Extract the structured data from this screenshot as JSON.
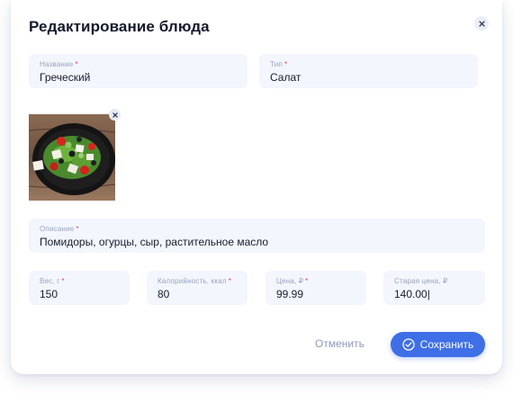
{
  "modal": {
    "title": "Редактирование блюда"
  },
  "fields": {
    "name": {
      "label": "Название",
      "value": "Греческий"
    },
    "type": {
      "label": "Тип",
      "value": "Салат"
    },
    "description": {
      "label": "Описание",
      "value": "Помидоры, огурцы, сыр, растительное масло"
    },
    "weight": {
      "label": "Вес, г",
      "value": "150"
    },
    "calories": {
      "label": "Калорийность, ккал",
      "value": "80"
    },
    "price": {
      "label": "Цена, ₽",
      "value": "99.99"
    },
    "old_price": {
      "label": "Старая цена, ₽",
      "value": "140.00|"
    }
  },
  "required_mark": "*",
  "actions": {
    "cancel_label": "Отменить",
    "save_label": "Сохранить"
  },
  "icons": {
    "close": "close-icon",
    "remove_photo": "close-icon",
    "save": "check-circle-icon"
  },
  "colors": {
    "accent": "#3f6fe6",
    "field_bg": "#f3f6fd",
    "required": "#e0455b"
  }
}
